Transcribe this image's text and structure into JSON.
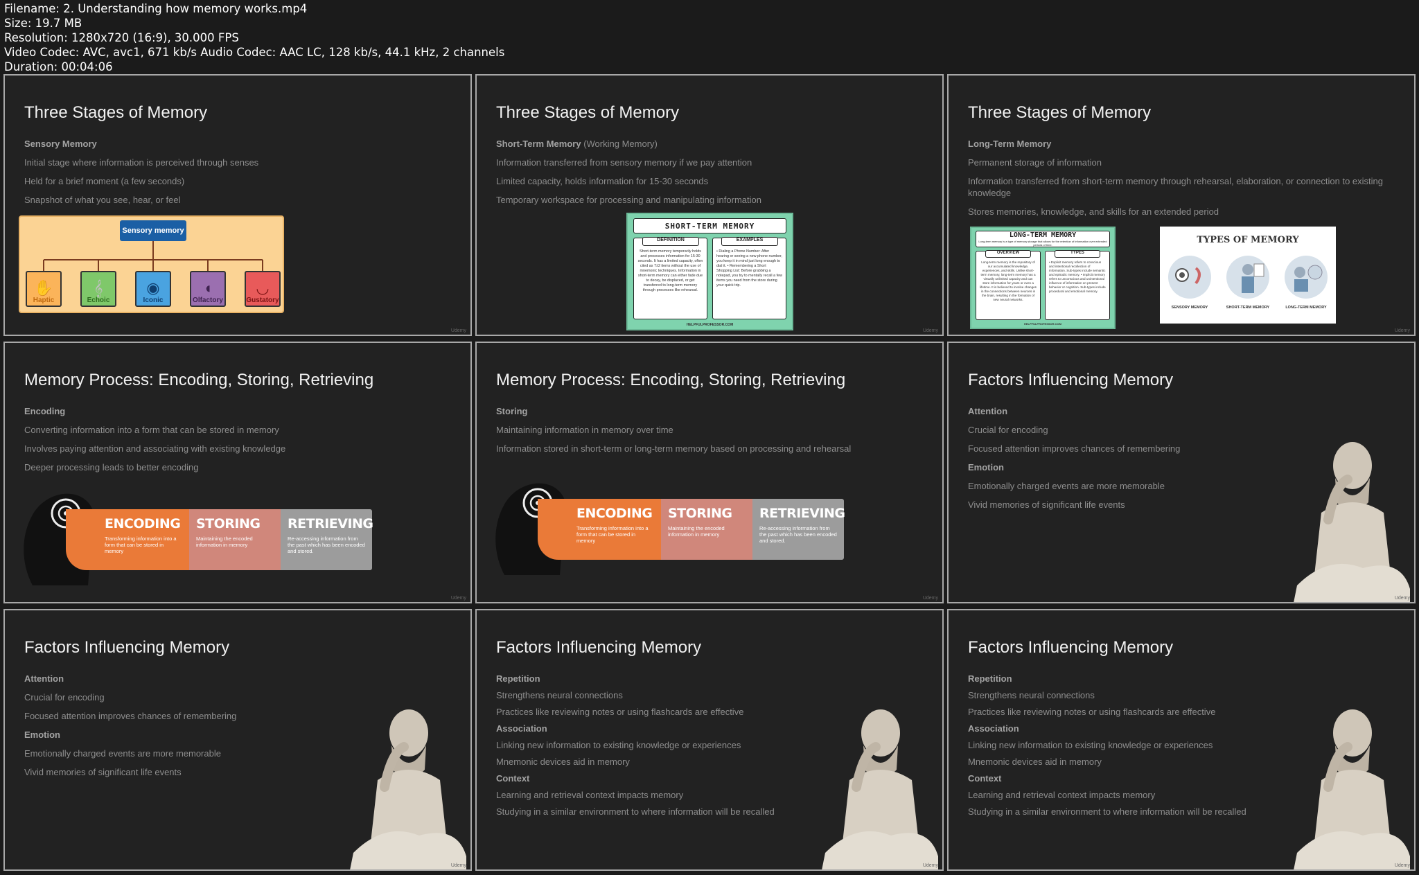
{
  "file_info": [
    "Filename: 2. Understanding how memory works.mp4",
    "Size: 19.7 MB",
    "Resolution: 1280x720 (16:9), 30.000 FPS",
    "Video Codec: AVC, avc1, 671 kb/s Audio Codec: AAC LC, 128 kb/s, 44.1 kHz, 2 channels",
    "Duration: 00:04:06"
  ],
  "watermark": "Udemy",
  "slides": {
    "s1": {
      "title": "Three Stages of Memory",
      "lines": [
        "Sensory Memory",
        "Initial stage where information is perceived through senses",
        "Held for a brief moment (a few seconds)",
        "Snapshot of what you see, hear, or feel"
      ],
      "diagram": {
        "root": "Sensory memory",
        "senses": [
          "Haptic",
          "Echoic",
          "Iconic",
          "Olfactory",
          "Gustatory"
        ],
        "colors": [
          "#fbb45a",
          "#7fc86a",
          "#4aa3e0",
          "#9b6fb0",
          "#e85a5a"
        ]
      }
    },
    "s2": {
      "title": "Three Stages of Memory",
      "head": "Short-Term Memory",
      "head_sub": "(Working Memory)",
      "lines": [
        "Information transferred from sensory memory if we pay attention",
        "Limited capacity, holds information for 15-30 seconds",
        "Temporary workspace for processing and manipulating information"
      ],
      "card": {
        "title": "SHORT-TERM MEMORY",
        "col1_tag": "DEFINITION",
        "col1_text": "Short-term memory temporarily holds and processes information for 15-30 seconds. It has a limited capacity, often cited as 7±2 items without the use of mnemonic techniques. Information in short-term memory can either fade due to decay, be displaced, or get transferred to long-term memory through processes like rehearsal.",
        "col2_tag": "EXAMPLES",
        "col2_text": "• Dialing a Phone Number: After hearing or seeing a new phone number, you keep it in mind just long enough to dial it. • Remembering a Short Shopping List: Before grabbing a notepad, you try to mentally recall a few items you need from the store during your quick trip.",
        "footer": "HELPFULPROFESSOR.COM"
      }
    },
    "s3": {
      "title": "Three Stages of Memory",
      "lines": [
        "Long-Term Memory",
        "Permanent storage of information",
        "Information transferred from short-term memory through rehearsal, elaboration, or connection to existing knowledge",
        "Stores memories, knowledge, and skills for an extended period"
      ],
      "card": {
        "title": "LONG-TERM MEMORY",
        "subtitle": "Long-term memory is a type of memory storage that allows for the retention of information over extended periods of time.",
        "col1_tag": "OVERVIEW",
        "col1_text": "Long-term memory is the repository of our accumulated knowledge, experiences, and skills. Unlike short-term memory, long-term memory has a virtually unlimited capacity and can store information for years or even a lifetime. It is believed to involve changes in the connections between neurons in the brain, resulting in the formation of new neural networks.",
        "col2_tag": "TYPES",
        "col2_text": "• Explicit memory refers to conscious and intentional recollection of information. Sub-types include semantic and episodic memory. • Implicit memory refers to unconscious and unintentional influence of information on present behavior or cognition. Sub-types include procedural and emotional memory.",
        "footer": "HELPFULPROFESSOR.COM"
      },
      "types": {
        "title": "TYPES OF MEMORY",
        "captions": [
          "SENSORY MEMORY",
          "SHORT-TERM MEMORY",
          "LONG-TERM MEMORY"
        ]
      }
    },
    "s4": {
      "title": "Memory Process: Encoding, Storing, Retrieving",
      "lines": [
        "Encoding",
        "Converting information into a form that can be stored in memory",
        "Involves paying attention and associating with existing knowledge",
        "Deeper processing leads to better encoding"
      ]
    },
    "s5": {
      "title": "Memory Process: Encoding, Storing, Retrieving",
      "lines": [
        "Storing",
        "Maintaining information in memory over time",
        "Information stored in short-term or long-term memory based on processing and rehearsal"
      ]
    },
    "process": {
      "encoding": {
        "label": "ENCODING",
        "desc": "Transforming information into a form that can be stored in memory"
      },
      "storing": {
        "label": "STORING",
        "desc": "Maintaining the encoded information in memory"
      },
      "retrieving": {
        "label": "RETRIEVING",
        "desc": "Re-accessing information from the past which has been encoded and stored."
      }
    },
    "s6": {
      "title": "Factors Influencing Memory",
      "lines": [
        "Attention",
        "Crucial for encoding",
        "Focused attention improves chances of remembering",
        "Emotion",
        "Emotionally charged events are more memorable",
        "Vivid memories of significant life events"
      ]
    },
    "s7": {
      "title": "Factors Influencing Memory",
      "lines": [
        "Attention",
        "Crucial for encoding",
        "Focused attention improves chances of remembering",
        "Emotion",
        "Emotionally charged events are more memorable",
        "Vivid memories of significant life events"
      ]
    },
    "s8": {
      "title": "Factors Influencing Memory",
      "lines": [
        "Repetition",
        "Strengthens neural connections",
        "Practices like reviewing notes or using flashcards are effective",
        "Association",
        "Linking new information to existing knowledge or experiences",
        "Mnemonic devices aid in memory",
        "Context",
        "Learning and retrieval context impacts memory",
        "Studying in a similar environment to where information will be recalled"
      ]
    },
    "s9": {
      "title": "Factors Influencing Memory",
      "lines": [
        "Repetition",
        "Strengthens neural connections",
        "Practices like reviewing notes or using flashcards are effective",
        "Association",
        "Linking new information to existing knowledge or experiences",
        "Mnemonic devices aid in memory",
        "Context",
        "Learning and retrieval context impacts memory",
        "Studying in a similar environment to where information will be recalled"
      ]
    }
  }
}
